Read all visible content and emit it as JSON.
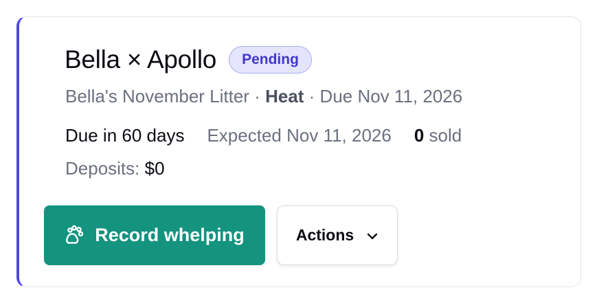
{
  "litter": {
    "title": "Bella × Apollo",
    "status": "Pending",
    "subtitle_name": "Bella's November Litter",
    "separator": " · ",
    "cycle_type": "Heat",
    "due_text": "Due Nov 11, 2026",
    "due_in": "Due in 60 days",
    "expected": "Expected Nov 11, 2026",
    "sold_count": "0",
    "sold_label": "sold",
    "deposits_label": "Deposits:",
    "deposits_value": "$0"
  },
  "actions": {
    "primary_label": "Record whelping",
    "primary_icon": "paw-icon",
    "secondary_label": "Actions",
    "secondary_icon": "chevron-down-icon"
  },
  "colors": {
    "accent": "#5046e5",
    "primary_button": "#14937f",
    "badge_bg": "#e4e5fd",
    "badge_text": "#4338ca"
  }
}
